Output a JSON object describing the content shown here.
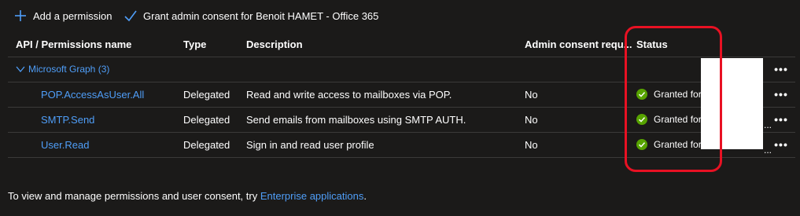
{
  "toolbar": {
    "add_label": "Add a permission",
    "consent_label": "Grant admin consent for Benoit HAMET - Office 365"
  },
  "table": {
    "headers": {
      "name": "API / Permissions name",
      "type": "Type",
      "description": "Description",
      "admin": "Admin consent requ...",
      "status": "Status"
    },
    "group": {
      "label": "Microsoft Graph (3)"
    },
    "rows": [
      {
        "name": "POP.AccessAsUser.All",
        "type": "Delegated",
        "description": "Read and write access to mailboxes via POP.",
        "admin": "No",
        "status": "Granted for"
      },
      {
        "name": "SMTP.Send",
        "type": "Delegated",
        "description": "Send emails from mailboxes using SMTP AUTH.",
        "admin": "No",
        "status": "Granted for"
      },
      {
        "name": "User.Read",
        "type": "Delegated",
        "description": "Sign in and read user profile",
        "admin": "No",
        "status": "Granted for"
      }
    ],
    "more_glyph": "•••",
    "trail_ellipsis": "..."
  },
  "footer": {
    "text": "To view and manage permissions and user consent, try ",
    "link": "Enterprise applications",
    "end": "."
  },
  "colors": {
    "background": "#1b1a19",
    "link": "#4f9ef8",
    "success": "#57a300",
    "highlight": "#e81123"
  }
}
